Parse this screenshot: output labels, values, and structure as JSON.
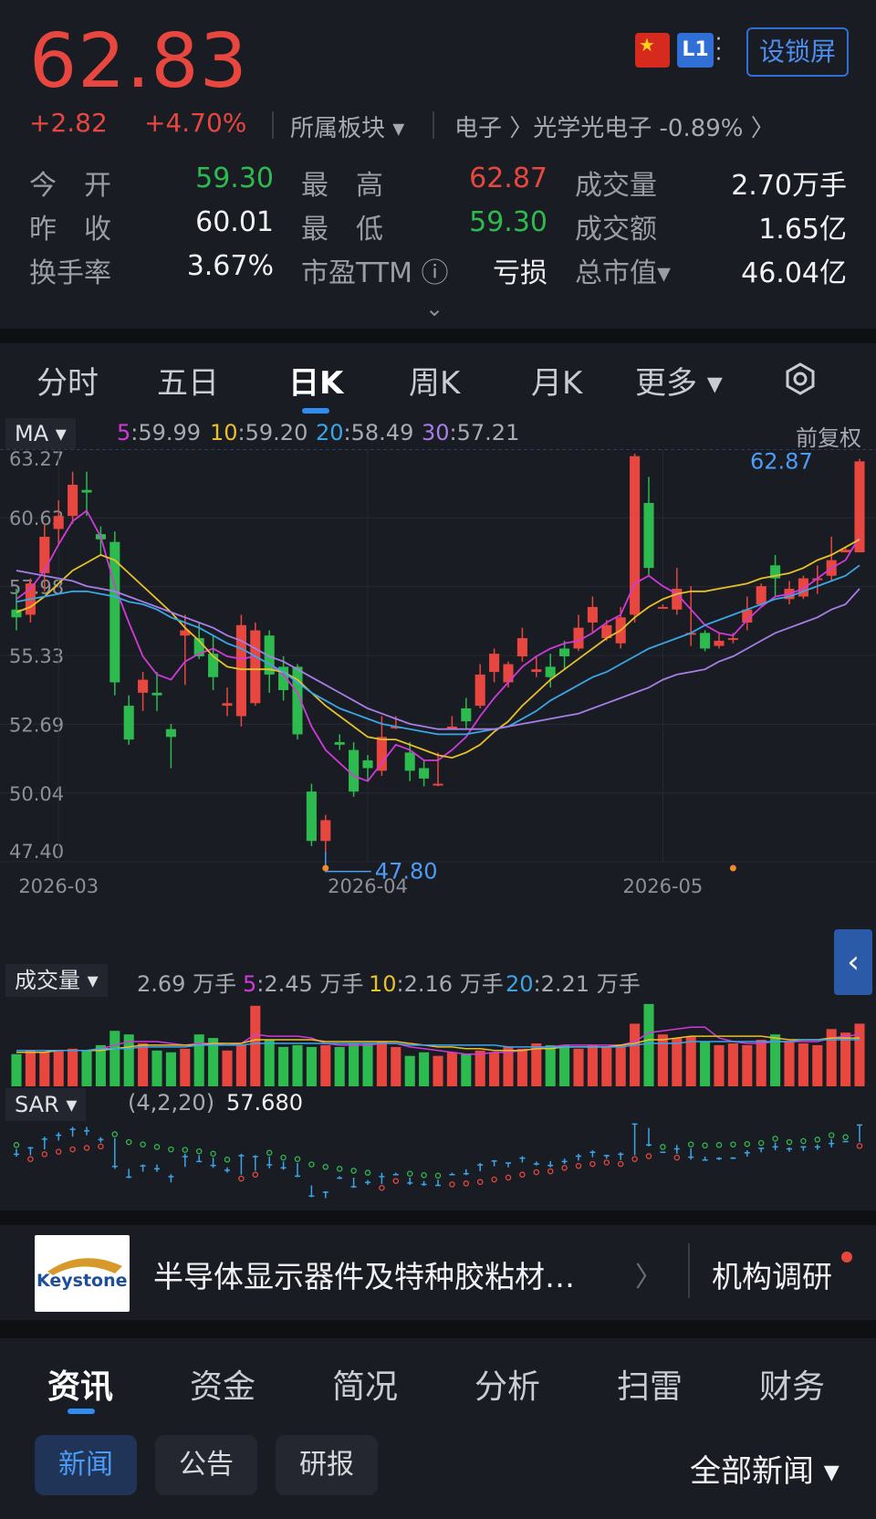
{
  "header": {
    "price": "62.83",
    "change": "+2.82",
    "change_pct": "+4.70%",
    "sector_label": "所属板块 ▾",
    "sector_path": "电子 〉光学光电子 -0.89% 〉",
    "badge_l1": "L1",
    "lock_button": "设锁屏",
    "flag_icon": "china-flag-icon",
    "expand_icon": "chevron-down-icon"
  },
  "quotes": {
    "rows": [
      [
        {
          "label": "今　开",
          "value": "59.30",
          "color": "#2dbb4f"
        },
        {
          "label": "最　高",
          "value": "62.87",
          "color": "#e8473f"
        },
        {
          "label": "成交量",
          "value": "2.70万手",
          "color": "#f1f2f4"
        }
      ],
      [
        {
          "label": "昨　收",
          "value": "60.01",
          "color": "#f1f2f4"
        },
        {
          "label": "最　低",
          "value": "59.30",
          "color": "#2dbb4f"
        },
        {
          "label": "成交额",
          "value": "1.65亿",
          "color": "#f1f2f4"
        }
      ],
      [
        {
          "label": "换手率",
          "value": "3.67%",
          "color": "#f1f2f4"
        },
        {
          "label": "市盈TTM ⓘ",
          "value": "亏损",
          "color": "#f1f2f4"
        },
        {
          "label": "总市值▾",
          "value": "46.04亿",
          "color": "#f1f2f4"
        }
      ]
    ]
  },
  "chart_tabs": [
    "分时",
    "五日",
    "日K",
    "周K",
    "月K",
    "更多 ▾"
  ],
  "chart_tab_active": "日K",
  "settings_icon": "gear-icon",
  "ma_legend": {
    "selector": "MA ▾",
    "items": [
      {
        "key": "5",
        "val": ":59.99",
        "color": "#d03ad8"
      },
      {
        "key": "10",
        "val": ":59.20",
        "color": "#e8c02a"
      },
      {
        "key": "20",
        "val": ":58.49",
        "color": "#3aa6e8"
      },
      {
        "key": "30",
        "val": ":57.21",
        "color": "#a67ee8"
      }
    ],
    "adjust": "前复权"
  },
  "chart_data": {
    "type": "candlestick",
    "y_ticks": [
      "63.27",
      "60.63",
      "57.98",
      "55.33",
      "52.69",
      "50.04",
      "47.40"
    ],
    "ylim": [
      47.4,
      63.27
    ],
    "x_labels": [
      "2026-03",
      "2026-04",
      "2026-05"
    ],
    "x_label_index": [
      3,
      25,
      46
    ],
    "high_marker": "62.87",
    "low_marker": "47.80",
    "candles": [
      [
        57.1,
        56.8,
        57.9,
        56.3
      ],
      [
        56.9,
        58.1,
        58.3,
        56.6
      ],
      [
        58.5,
        59.9,
        60.4,
        57.8
      ],
      [
        60.2,
        60.7,
        61.3,
        59.6
      ],
      [
        60.7,
        61.9,
        62.4,
        60.4
      ],
      [
        61.7,
        61.6,
        62.4,
        60.7
      ],
      [
        60.0,
        59.8,
        60.3,
        59.2
      ],
      [
        59.7,
        54.3,
        60.1,
        53.8
      ],
      [
        53.4,
        52.1,
        53.8,
        51.9
      ],
      [
        53.9,
        54.4,
        54.7,
        53.2
      ],
      [
        53.9,
        53.8,
        54.7,
        53.2
      ],
      [
        52.5,
        52.2,
        52.7,
        51.0
      ],
      [
        56.1,
        56.3,
        56.9,
        54.2
      ],
      [
        56.0,
        55.3,
        56.6,
        55.2
      ],
      [
        55.4,
        54.5,
        56.1,
        54.0
      ],
      [
        53.4,
        53.5,
        54.1,
        53.0
      ],
      [
        53.0,
        56.5,
        56.9,
        52.6
      ],
      [
        53.5,
        56.3,
        56.6,
        53.4
      ],
      [
        56.1,
        54.6,
        56.3,
        53.9
      ],
      [
        54.9,
        54.0,
        55.3,
        53.6
      ],
      [
        54.9,
        52.3,
        55.0,
        52.1
      ],
      [
        50.1,
        48.2,
        50.4,
        48.0
      ],
      [
        48.2,
        49.0,
        49.2,
        47.8
      ],
      [
        52.0,
        51.9,
        52.3,
        51.7
      ],
      [
        51.7,
        50.1,
        52.0,
        49.9
      ],
      [
        51.3,
        51.0,
        51.5,
        50.5
      ],
      [
        50.9,
        52.2,
        53.0,
        50.7
      ],
      [
        52.6,
        52.6,
        53.0,
        52.5
      ],
      [
        51.6,
        50.9,
        52.0,
        50.5
      ],
      [
        51.0,
        50.6,
        51.3,
        50.3
      ],
      [
        50.4,
        50.4,
        51.6,
        50.3
      ],
      [
        52.5,
        52.6,
        53.0,
        52.5
      ],
      [
        53.3,
        52.8,
        53.7,
        52.5
      ],
      [
        53.4,
        54.6,
        55.0,
        53.3
      ],
      [
        54.7,
        55.4,
        55.6,
        54.3
      ],
      [
        54.3,
        55.0,
        55.1,
        54.1
      ],
      [
        55.3,
        56.0,
        56.4,
        55.1
      ],
      [
        54.7,
        54.8,
        55.3,
        54.5
      ],
      [
        54.9,
        54.5,
        55.4,
        54.1
      ],
      [
        55.6,
        55.3,
        55.9,
        54.8
      ],
      [
        55.6,
        56.4,
        56.9,
        55.5
      ],
      [
        56.6,
        57.2,
        57.6,
        56.2
      ],
      [
        56.0,
        56.5,
        56.7,
        55.9
      ],
      [
        55.8,
        56.8,
        57.2,
        55.6
      ],
      [
        56.9,
        63.0,
        63.1,
        56.6
      ],
      [
        61.2,
        58.7,
        62.2,
        58.4
      ],
      [
        57.2,
        57.2,
        57.3,
        57.2
      ],
      [
        57.1,
        57.9,
        58.7,
        56.9
      ],
      [
        56.2,
        56.2,
        58.0,
        55.7
      ],
      [
        56.2,
        55.6,
        56.3,
        55.5
      ],
      [
        55.7,
        55.9,
        56.2,
        55.6
      ],
      [
        56.0,
        56.0,
        56.2,
        55.8
      ],
      [
        56.6,
        57.1,
        57.6,
        56.3
      ],
      [
        57.3,
        58.0,
        58.1,
        57.2
      ],
      [
        58.8,
        58.3,
        59.2,
        57.6
      ],
      [
        57.5,
        57.9,
        58.2,
        57.3
      ],
      [
        57.6,
        58.3,
        58.4,
        57.5
      ],
      [
        58.3,
        58.3,
        58.8,
        57.7
      ],
      [
        58.4,
        59.0,
        59.9,
        58.2
      ],
      [
        59.3,
        59.4,
        59.5,
        59.3
      ],
      [
        59.3,
        62.8,
        62.9,
        59.3
      ]
    ],
    "ma5": [
      57.5,
      57.9,
      58.6,
      59.6,
      60.5,
      60.9,
      59.9,
      58.0,
      56.6,
      55.3,
      54.6,
      54.4,
      55.1,
      55.4,
      55.6,
      55.3,
      55.2,
      55.3,
      55.0,
      54.6,
      53.9,
      52.6,
      51.7,
      51.2,
      50.7,
      50.5,
      51.2,
      51.9,
      51.7,
      51.3,
      51.3,
      51.7,
      52.2,
      53.0,
      53.7,
      54.3,
      54.9,
      55.3,
      55.6,
      55.8,
      55.9,
      56.2,
      56.6,
      56.9,
      58.1,
      58.4,
      58.0,
      57.7,
      57.1,
      56.5,
      56.2,
      56.1,
      56.7,
      57.2,
      57.6,
      57.7,
      57.9,
      58.3,
      58.7,
      59.0,
      59.9
    ],
    "ma10": [
      57.0,
      57.2,
      57.6,
      58.1,
      58.6,
      58.9,
      59.2,
      59.0,
      58.5,
      58.0,
      57.5,
      57.0,
      56.4,
      55.9,
      55.3,
      54.9,
      54.8,
      54.8,
      54.8,
      54.7,
      54.4,
      53.9,
      53.4,
      53.0,
      52.6,
      52.2,
      52.1,
      52.1,
      51.9,
      51.7,
      51.5,
      51.4,
      51.6,
      51.9,
      52.4,
      52.8,
      53.4,
      53.9,
      54.4,
      54.8,
      55.2,
      55.6,
      56.0,
      56.3,
      56.8,
      57.2,
      57.5,
      57.7,
      57.8,
      57.8,
      57.9,
      58.0,
      58.1,
      58.3,
      58.4,
      58.5,
      58.7,
      59.0,
      59.2,
      59.5,
      59.8
    ],
    "ma20": [
      57.4,
      57.5,
      57.6,
      57.7,
      57.8,
      57.8,
      57.7,
      57.6,
      57.4,
      57.3,
      57.1,
      56.8,
      56.6,
      56.4,
      56.1,
      55.8,
      55.6,
      55.3,
      55.0,
      54.7,
      54.3,
      53.9,
      53.6,
      53.3,
      53.1,
      52.9,
      52.7,
      52.6,
      52.5,
      52.4,
      52.3,
      52.3,
      52.3,
      52.4,
      52.5,
      52.6,
      52.9,
      53.2,
      53.6,
      53.9,
      54.2,
      54.5,
      54.7,
      55.0,
      55.3,
      55.6,
      55.8,
      56.0,
      56.2,
      56.5,
      56.7,
      56.9,
      57.1,
      57.3,
      57.5,
      57.6,
      57.8,
      58.0,
      58.2,
      58.4,
      58.8
    ],
    "ma30": [
      58.6,
      58.5,
      58.4,
      58.3,
      58.2,
      58.0,
      57.9,
      57.8,
      57.6,
      57.4,
      57.2,
      57.0,
      56.8,
      56.6,
      56.4,
      56.1,
      55.9,
      55.6,
      55.3,
      55.1,
      54.8,
      54.5,
      54.2,
      53.9,
      53.6,
      53.3,
      53.1,
      52.9,
      52.7,
      52.6,
      52.5,
      52.5,
      52.5,
      52.5,
      52.5,
      52.6,
      52.7,
      52.8,
      52.9,
      53.0,
      53.1,
      53.3,
      53.5,
      53.7,
      53.9,
      54.1,
      54.4,
      54.6,
      54.7,
      54.8,
      55.1,
      55.3,
      55.6,
      55.9,
      56.2,
      56.4,
      56.6,
      56.8,
      57.1,
      57.3,
      57.9
    ]
  },
  "volume": {
    "selector": "成交量 ▾",
    "items": [
      {
        "key": "",
        "val": "2.69 万手",
        "color": "#a7aab2"
      },
      {
        "key": "5",
        "val": ":2.45 万手",
        "color": "#d03ad8"
      },
      {
        "key": "10",
        "val": ":2.16 万手",
        "color": "#e8c02a"
      },
      {
        "key": "20",
        "val": ":2.21 万手",
        "color": "#3aa6e8"
      }
    ],
    "bars": [
      1.8,
      2.0,
      1.9,
      2.0,
      2.1,
      2.0,
      2.3,
      3.1,
      2.9,
      2.4,
      2.0,
      1.9,
      2.1,
      2.9,
      2.7,
      2.0,
      2.3,
      4.5,
      2.6,
      2.2,
      2.3,
      2.2,
      2.3,
      2.2,
      2.4,
      2.4,
      2.5,
      2.2,
      1.7,
      1.9,
      1.7,
      1.9,
      1.8,
      2.0,
      1.9,
      2.2,
      2.1,
      2.4,
      2.3,
      2.3,
      2.1,
      2.3,
      2.2,
      2.3,
      3.5,
      4.6,
      2.9,
      2.7,
      2.8,
      2.5,
      2.3,
      2.4,
      2.3,
      2.6,
      2.9,
      2.5,
      2.4,
      2.3,
      3.2,
      3.0,
      3.5
    ],
    "ma5": [
      1.9,
      1.9,
      1.9,
      2.0,
      2.0,
      2.0,
      2.1,
      2.3,
      2.5,
      2.5,
      2.5,
      2.4,
      2.3,
      2.4,
      2.4,
      2.3,
      2.4,
      2.9,
      2.8,
      2.8,
      2.8,
      2.7,
      2.4,
      2.3,
      2.3,
      2.3,
      2.4,
      2.4,
      2.2,
      2.1,
      2.0,
      1.9,
      1.8,
      1.8,
      1.9,
      1.9,
      2.0,
      2.1,
      2.2,
      2.3,
      2.3,
      2.3,
      2.3,
      2.3,
      2.5,
      3.0,
      3.1,
      3.2,
      3.3,
      3.3,
      2.7,
      2.5,
      2.4,
      2.4,
      2.5,
      2.5,
      2.5,
      2.5,
      2.7,
      2.8,
      2.9
    ],
    "ma10": [
      1.9,
      1.9,
      1.9,
      2.0,
      2.0,
      2.0,
      2.0,
      2.1,
      2.2,
      2.3,
      2.3,
      2.3,
      2.3,
      2.3,
      2.4,
      2.4,
      2.4,
      2.6,
      2.6,
      2.6,
      2.6,
      2.6,
      2.5,
      2.5,
      2.5,
      2.5,
      2.5,
      2.5,
      2.4,
      2.3,
      2.2,
      2.2,
      2.1,
      2.1,
      2.0,
      2.0,
      2.0,
      2.1,
      2.1,
      2.2,
      2.2,
      2.2,
      2.2,
      2.3,
      2.4,
      2.6,
      2.6,
      2.7,
      2.8,
      2.8,
      2.8,
      2.8,
      2.8,
      2.8,
      2.7,
      2.6,
      2.6,
      2.6,
      2.7,
      2.7,
      2.7
    ],
    "ma20": [
      2.0,
      2.0,
      2.0,
      2.0,
      2.0,
      2.0,
      2.1,
      2.1,
      2.1,
      2.2,
      2.2,
      2.2,
      2.2,
      2.3,
      2.3,
      2.3,
      2.3,
      2.4,
      2.4,
      2.4,
      2.4,
      2.4,
      2.4,
      2.4,
      2.4,
      2.4,
      2.4,
      2.4,
      2.3,
      2.3,
      2.3,
      2.3,
      2.3,
      2.3,
      2.3,
      2.2,
      2.2,
      2.2,
      2.2,
      2.2,
      2.2,
      2.2,
      2.2,
      2.2,
      2.3,
      2.4,
      2.4,
      2.4,
      2.5,
      2.5,
      2.5,
      2.5,
      2.5,
      2.5,
      2.5,
      2.5,
      2.6,
      2.6,
      2.6,
      2.6,
      2.6
    ]
  },
  "sar": {
    "selector": "SAR ▾",
    "params": "(4,2,20)",
    "value": "57.680"
  },
  "news_banner": {
    "logo_text": "Keystone",
    "text": "半导体显示器件及特种胶粘材…",
    "arrow": "〉",
    "research": "机构调研"
  },
  "bottom_tabs": [
    "资讯",
    "资金",
    "简况",
    "分析",
    "扫雷",
    "财务"
  ],
  "bottom_tab_active": "资讯",
  "chips": [
    "新闻",
    "公告",
    "研报"
  ],
  "chip_active": "新闻",
  "all_news": "全部新闻 ▾",
  "colors": {
    "up": "#e8473f",
    "down": "#2dbb4f",
    "accent": "#2f8cf0"
  }
}
